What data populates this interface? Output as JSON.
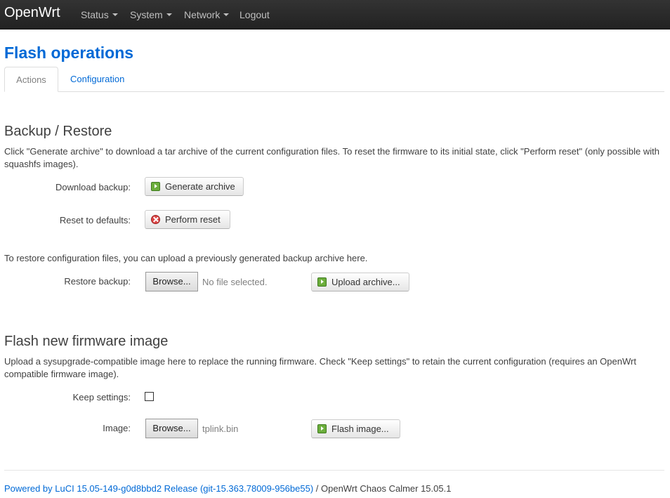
{
  "navbar": {
    "brand": "OpenWrt",
    "items": [
      {
        "label": "Status",
        "dropdown": true
      },
      {
        "label": "System",
        "dropdown": true
      },
      {
        "label": "Network",
        "dropdown": true
      },
      {
        "label": "Logout",
        "dropdown": false
      }
    ]
  },
  "page": {
    "title": "Flash operations",
    "tabs": [
      {
        "label": "Actions",
        "active": true
      },
      {
        "label": "Configuration",
        "active": false
      }
    ]
  },
  "backup": {
    "heading": "Backup / Restore",
    "description": "Click \"Generate archive\" to download a tar archive of the current configuration files. To reset the firmware to its initial state, click \"Perform reset\" (only possible with squashfs images).",
    "download_label": "Download backup:",
    "generate_button": "Generate archive",
    "reset_label": "Reset to defaults:",
    "reset_button": "Perform reset",
    "restore_description": "To restore configuration files, you can upload a previously generated backup archive here.",
    "restore_label": "Restore backup:",
    "browse_button": "Browse...",
    "restore_file": "No file selected.",
    "upload_button": "Upload archive..."
  },
  "flash": {
    "heading": "Flash new firmware image",
    "description": "Upload a sysupgrade-compatible image here to replace the running firmware. Check \"Keep settings\" to retain the current configuration (requires an OpenWrt compatible firmware image).",
    "keep_label": "Keep settings:",
    "keep_checked": false,
    "image_label": "Image:",
    "browse_button": "Browse...",
    "image_file": "tplink.bin",
    "flash_button": "Flash image..."
  },
  "footer": {
    "link_text": "Powered by LuCI 15.05-149-g0d8bbd2 Release (git-15.363.78009-956be55)",
    "suffix": " / OpenWrt Chaos Calmer 15.05.1"
  },
  "colors": {
    "link": "#0069d6",
    "navbar": "#222222",
    "text": "#404040"
  },
  "icons": [
    "go-icon",
    "reset-icon",
    "caret-down-icon"
  ]
}
